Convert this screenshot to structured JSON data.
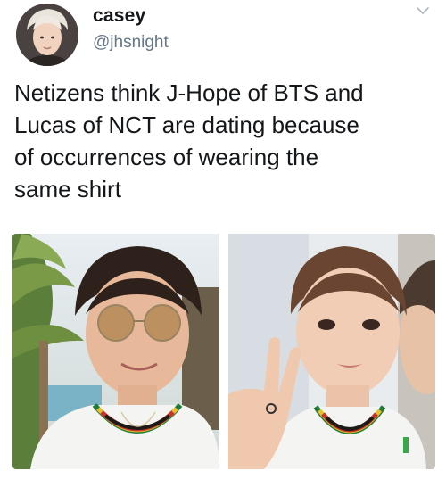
{
  "tweet": {
    "author": {
      "name": "casey",
      "handle": "@jhsnight"
    },
    "text": "Netizens think J-Hope of BTS and\nLucas of NCT are dating because\nof occurrences of wearing the\nsame shirt",
    "media": [
      {
        "icon": "photo-jhope-sunglasses"
      },
      {
        "icon": "photo-lucas-peace-sign"
      }
    ]
  },
  "colors": {
    "text": "#14171a",
    "secondary_text": "#657786",
    "background": "#ffffff"
  }
}
